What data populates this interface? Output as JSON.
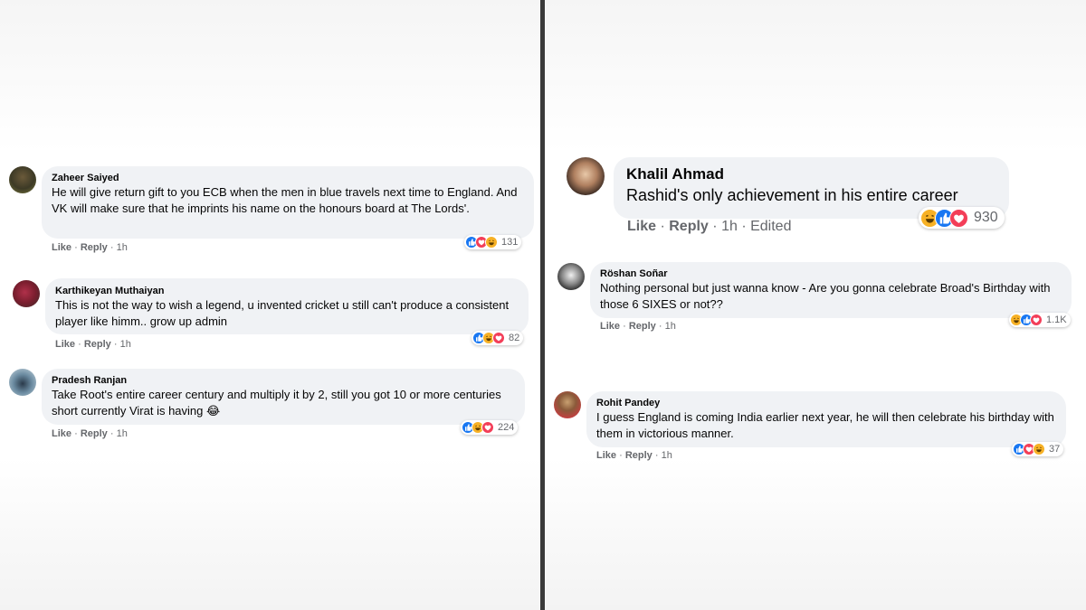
{
  "left_comments": [
    {
      "name": "Zaheer Saiyed",
      "text": "He will give return gift to you ECB when the men in blue travels next time to England. And VK will make sure that he imprints his name on the honours board at The Lords'.",
      "actions": {
        "like": "Like",
        "sep": "·",
        "reply": "Reply",
        "time": "1h"
      },
      "reactions": {
        "icons": [
          "like",
          "love",
          "haha"
        ],
        "count": "131"
      }
    },
    {
      "name": "Karthikeyan Muthaiyan",
      "text": "This is not the way to wish a legend, u invented cricket u still can't produce a consistent player like himm.. grow up admin",
      "actions": {
        "like": "Like",
        "sep": "·",
        "reply": "Reply",
        "time": "1h"
      },
      "reactions": {
        "icons": [
          "like",
          "haha",
          "love"
        ],
        "count": "82"
      }
    },
    {
      "name": "Pradesh Ranjan",
      "text": "Take Root's entire career century and multiply it by 2, still you got 10 or more centuries short currently Virat is having 😂",
      "actions": {
        "like": "Like",
        "sep": "·",
        "reply": "Reply",
        "time": "1h"
      },
      "reactions": {
        "icons": [
          "like",
          "haha",
          "love"
        ],
        "count": "224"
      }
    }
  ],
  "right_comments": [
    {
      "name": "Khalil Ahmad",
      "text": "Rashid's only achievement in his entire career",
      "actions": {
        "like": "Like",
        "sep": "·",
        "reply": "Reply",
        "time": "1h",
        "edited": "Edited"
      },
      "reactions": {
        "icons": [
          "haha",
          "like",
          "love"
        ],
        "count": "930"
      }
    },
    {
      "name": "Röshan Soñar",
      "text": "Nothing personal but just wanna know - Are you gonna celebrate Broad's Birthday with those 6 SIXES or not??",
      "actions": {
        "like": "Like",
        "sep": "·",
        "reply": "Reply",
        "time": "1h"
      },
      "reactions": {
        "icons": [
          "haha",
          "like",
          "love"
        ],
        "count": "1.1K"
      }
    },
    {
      "name": "Rohit Pandey",
      "text": "I guess England is coming India earlier next year, he will then celebrate his birthday with them in victorious manner.",
      "actions": {
        "like": "Like",
        "sep": "·",
        "reply": "Reply",
        "time": "1h"
      },
      "reactions": {
        "icons": [
          "like",
          "love",
          "haha"
        ],
        "count": "37"
      }
    }
  ],
  "colors": {
    "bubble": "#f0f2f5",
    "text": "#050505",
    "meta": "#65676b",
    "like": "#1877f2",
    "love": "#f33e58",
    "haha": "#f7b125"
  }
}
